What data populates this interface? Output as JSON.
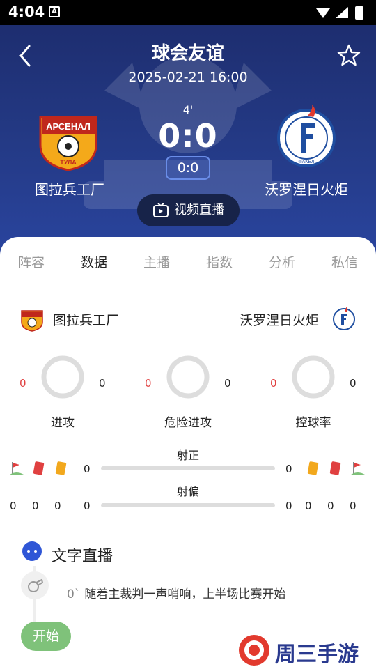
{
  "status_bar": {
    "time": "4:04",
    "notif_letter": "A"
  },
  "header": {
    "title": "球会友谊",
    "datetime": "2025-02-21 16:00",
    "minute": "4'",
    "score": "0:0",
    "half_score": "0:0",
    "video_label": "视频直播"
  },
  "teams": {
    "home": {
      "name": "图拉兵工厂",
      "logo_text": "АРСЕНАЛ",
      "logo_sub": "ТУЛА"
    },
    "away": {
      "name": "沃罗涅日火炬",
      "logo_text": "ФАКЕЛ"
    }
  },
  "tabs": [
    {
      "label": "阵容"
    },
    {
      "label": "数据"
    },
    {
      "label": "主播"
    },
    {
      "label": "指数"
    },
    {
      "label": "分析"
    },
    {
      "label": "私信"
    }
  ],
  "active_tab": "数据",
  "rings": [
    {
      "label": "进攻",
      "home": "0",
      "away": "0"
    },
    {
      "label": "危险进攻",
      "home": "0",
      "away": "0"
    },
    {
      "label": "控球率",
      "home": "0",
      "away": "0"
    }
  ],
  "bars": [
    {
      "label": "射正",
      "home": "0",
      "away": "0"
    },
    {
      "label": "射偏",
      "home": "0",
      "away": "0"
    }
  ],
  "cards": {
    "home": {
      "corners": "0",
      "red": "0",
      "yellow": "0"
    },
    "away": {
      "yellow": "0",
      "red": "0",
      "corners": "0"
    }
  },
  "live": {
    "title": "文字直播",
    "events": [
      {
        "minute": "0`",
        "text": "随着主裁判一声哨响，上半场比赛开始"
      }
    ],
    "start_label": "开始"
  },
  "watermark": {
    "text": "周三手游网"
  },
  "colors": {
    "accent": "#243a86",
    "red": "#e04040",
    "green": "#7fc27a"
  }
}
